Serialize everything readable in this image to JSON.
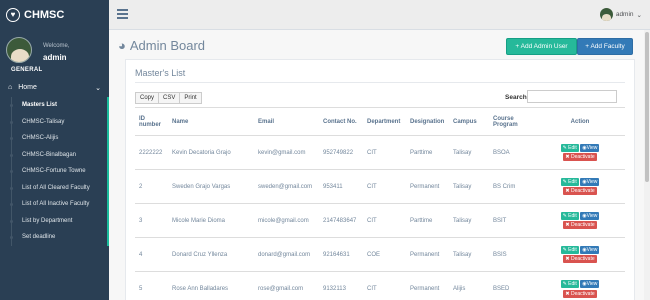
{
  "brand": {
    "name": "CHMSC",
    "logo_icon": "heart-icon"
  },
  "profile": {
    "welcome": "Welcome,",
    "username": "admin",
    "section": "GENERAL"
  },
  "menu": {
    "home": "Home",
    "items": [
      "Masters List",
      "CHMSC-Talisay",
      "CHMSC-Alijis",
      "CHMSC-Binalbagan",
      "CHMSC-Fortune Towne",
      "List of All Cleared Faculty",
      "List of All Inactive Faculty",
      "List by Department",
      "Set deadline"
    ]
  },
  "topbar": {
    "user": "admin"
  },
  "page": {
    "title": "Admin Board",
    "add_admin": "+ Add Admin User",
    "add_faculty": "+ Add Faculty"
  },
  "panel": {
    "title": "Master's List",
    "export": [
      "Copy",
      "CSV",
      "Print"
    ],
    "search_label": "Search:",
    "search_value": ""
  },
  "table": {
    "headers": [
      "ID number",
      "Name",
      "Email",
      "Contact No.",
      "Department",
      "Designation",
      "Campus",
      "Course Program",
      "Action"
    ],
    "rows": [
      [
        "2222222",
        "Kevin Decatoria Grajo",
        "kevin@gmail.com",
        "952749822",
        "CIT",
        "Parttime",
        "Talisay",
        "BSOA"
      ],
      [
        "2",
        "Sweden Grajo Vargas",
        "sweden@gmail.com",
        "953411",
        "CIT",
        "Permanent",
        "Talisay",
        "BS Crim"
      ],
      [
        "3",
        "Micole Marie Dioma",
        "micole@gmail.com",
        "2147483647",
        "CIT",
        "Parttime",
        "Talisay",
        "BSIT"
      ],
      [
        "4",
        "Donard Cruz Yllenza",
        "donard@gmail.com",
        "92164631",
        "COE",
        "Permanent",
        "Talisay",
        "BSIS"
      ],
      [
        "5",
        "Rose Ann Balladares",
        "rose@gmail.com",
        "9132113",
        "CIT",
        "Permanent",
        "Alijis",
        "BSED"
      ]
    ],
    "actions": {
      "edit": "Edit",
      "view": "View",
      "deactivate": "Deactivate"
    }
  }
}
